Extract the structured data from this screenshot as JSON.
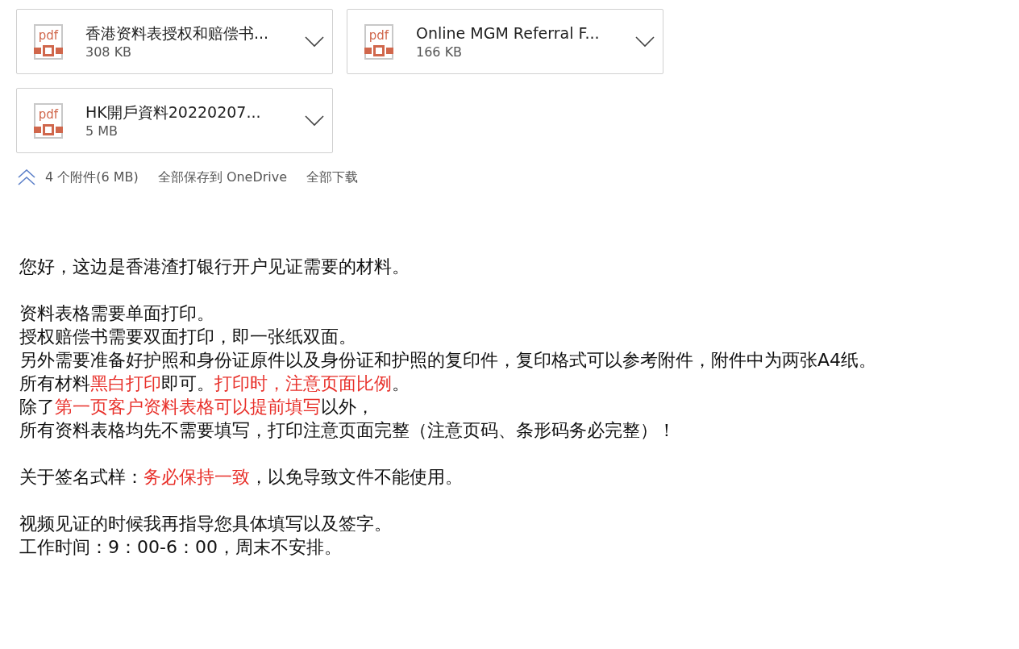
{
  "attachments": [
    {
      "icon_text": "pdf",
      "name": "香港资料表授权和赔偿书...",
      "size": "308 KB"
    },
    {
      "icon_text": "pdf",
      "name": "Online MGM Referral F...",
      "size": "166 KB"
    },
    {
      "icon_text": "pdf",
      "name": "HK開戶資料20220207...",
      "size": "5 MB"
    }
  ],
  "attachment_bar": {
    "expanded": true,
    "summary": "4 个附件(6 MB)",
    "save_all": "全部保存到 OneDrive",
    "download_all": "全部下载"
  },
  "body": [
    [
      [
        {
          "text": "您好，这边是香港渣打银行开户见证需要的材料。",
          "highlight": false
        }
      ]
    ],
    [
      [
        {
          "text": "资料表格需要单面打印。",
          "highlight": false
        }
      ],
      [
        {
          "text": "授权赔偿书需要双面打印，即一张纸双面。",
          "highlight": false
        }
      ],
      [
        {
          "text": "另外需要准备好护照和身份证原件以及身份证和护照的复印件，复印格式可以参考附件，附件中为两张A4纸。",
          "highlight": false
        }
      ],
      [
        {
          "text": "所有材料",
          "highlight": false
        },
        {
          "text": "黑白打印",
          "highlight": true
        },
        {
          "text": "即可。",
          "highlight": false
        },
        {
          "text": "打印时，注意页面比例",
          "highlight": true
        },
        {
          "text": "。",
          "highlight": false
        }
      ],
      [
        {
          "text": "除了",
          "highlight": false
        },
        {
          "text": "第一页客户资料表格可以提前填写",
          "highlight": true
        },
        {
          "text": "以外，",
          "highlight": false
        }
      ],
      [
        {
          "text": "所有资料表格均先不需要填写，打印注意页面完整（注意页码、条形码务必完整）！",
          "highlight": false
        }
      ]
    ],
    [
      [
        {
          "text": "关于签名式样：",
          "highlight": false
        },
        {
          "text": "务必保持一致",
          "highlight": true
        },
        {
          "text": "，以免导致文件不能使用。",
          "highlight": false
        }
      ]
    ],
    [
      [
        {
          "text": "视频见证的时候我再指导您具体填写以及签字。",
          "highlight": false
        }
      ],
      [
        {
          "text": "工作时间：9：00-6：00，周末不安排。",
          "highlight": false
        }
      ]
    ]
  ]
}
